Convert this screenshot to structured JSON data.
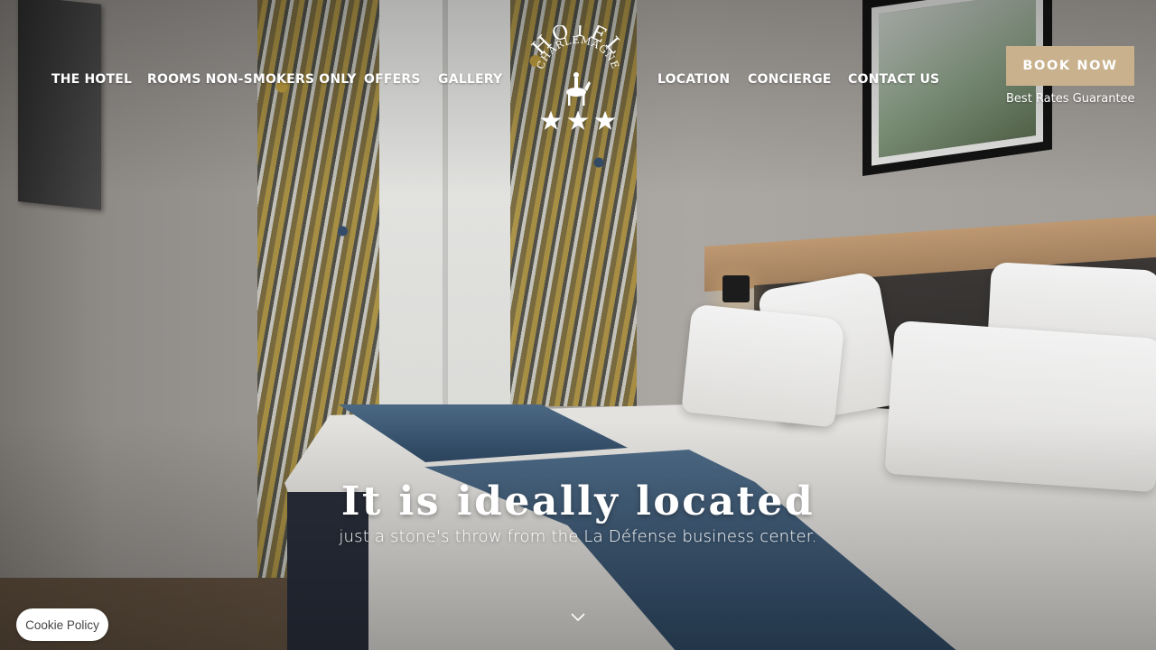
{
  "nav": {
    "left": [
      {
        "label": "THE HOTEL"
      },
      {
        "label": "ROOMS NON-SMOKERS ONLY"
      },
      {
        "label": "OFFERS"
      },
      {
        "label": "GALLERY"
      }
    ],
    "right": [
      {
        "label": "LOCATION"
      },
      {
        "label": "CONCIERGE"
      },
      {
        "label": "CONTACT US"
      }
    ]
  },
  "logo": {
    "arc_text": "HOTEL",
    "sub_text": "CHARLEMAGNE",
    "stars": 3,
    "icon": "horse-rider-icon"
  },
  "booking": {
    "button_label": "BOOK NOW",
    "note": "Best Rates Guarantee",
    "accent_color": "#c8b18c"
  },
  "hero": {
    "headline": "It is ideally located",
    "subline": "just a stone's throw from the La Défense business center."
  },
  "scroll": {
    "icon": "chevron-down-icon"
  },
  "cookie": {
    "label": "Cookie Policy"
  }
}
